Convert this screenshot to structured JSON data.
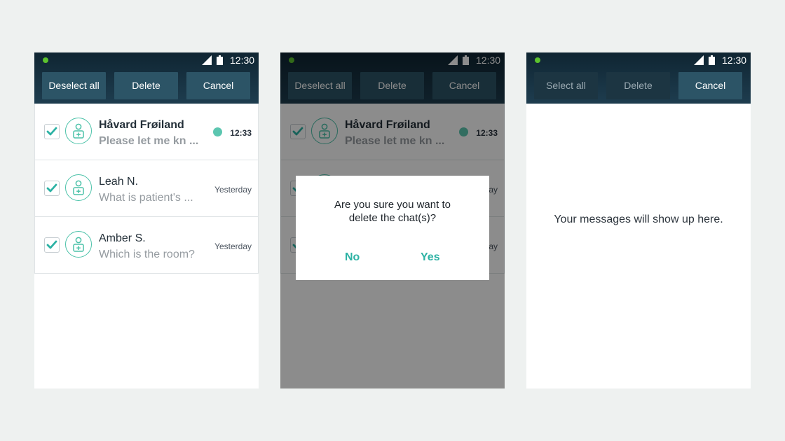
{
  "status_bar": {
    "time": "12:30",
    "dot_color": "#5cc22e",
    "icons": [
      "signal-icon",
      "battery-icon"
    ]
  },
  "colors": {
    "topbar": "#1e3d4f",
    "accent": "#4cc2a9",
    "dialog_button": "#2cb2a4",
    "background": "#eef1f0"
  },
  "screens": [
    {
      "buttons": [
        {
          "label": "Deselect all",
          "dim": false
        },
        {
          "label": "Delete",
          "dim": false
        },
        {
          "label": "Cancel",
          "dim": false
        }
      ],
      "chats": [
        {
          "name": "Håvard Frøiland",
          "preview": "Please let me kn ...",
          "time": "12:33",
          "unread": true,
          "checked": true,
          "avatar_icon": "doctor-icon"
        },
        {
          "name": "Leah N.",
          "preview": "What is patient's ...",
          "time": "Yesterday",
          "unread": false,
          "checked": true,
          "avatar_icon": "doctor-icon"
        },
        {
          "name": "Amber S.",
          "preview": "Which is the room?",
          "time": "Yesterday",
          "unread": false,
          "checked": true,
          "avatar_icon": "doctor-icon"
        }
      ]
    },
    {
      "buttons": [
        {
          "label": "Deselect all",
          "dim": true
        },
        {
          "label": "Delete",
          "dim": true
        },
        {
          "label": "Cancel",
          "dim": true
        }
      ],
      "chats": [
        {
          "name": "Håvard Frøiland",
          "preview": "Please let me kn ...",
          "time": "12:33",
          "unread": true,
          "checked": true
        },
        {
          "name": "",
          "preview": "",
          "time": "",
          "unread": false,
          "checked": true
        },
        {
          "name": "",
          "preview": "",
          "time": "",
          "unread": false,
          "checked": true
        }
      ],
      "dialog": {
        "message": "Are you sure you want to\ndelete the chat(s)?",
        "no_label": "No",
        "yes_label": "Yes"
      }
    },
    {
      "buttons": [
        {
          "label": "Select all",
          "dim": true
        },
        {
          "label": "Delete",
          "dim": true
        },
        {
          "label": "Cancel",
          "dim": false
        }
      ],
      "empty_message": "Your messages will show up here."
    }
  ]
}
